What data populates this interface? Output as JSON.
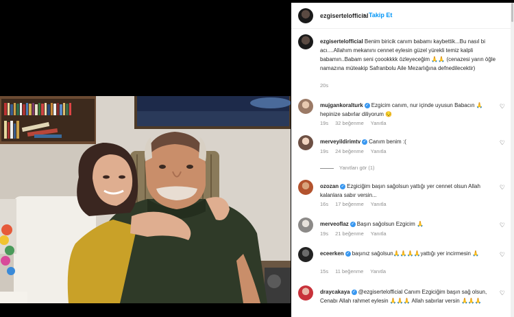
{
  "post": {
    "username": "ezgisertelofficial",
    "follow_dot": "•",
    "follow_label": "Takip Et"
  },
  "caption": {
    "username": "ezgisertelofficial",
    "text": " Benim biricik canım babamı kaybettik...Bu nasıl bi acı....Allahım mekanını cennet eylesin güzel yürekli temiz kalpli babamın..Babam seni çoookkkk özleyeceğim 🙏🙏 (cenazesi yarın öğle namazına müteakip Safranbolu Aile Mezarlığına defnedilecektir)",
    "time": "20s"
  },
  "comments": [
    {
      "username": "mujgankoralturk",
      "verified": true,
      "text": "Ezgicim canım, nur içinde uyusun Babacın 🙏 hepinize sabırlar diliyorum 😔",
      "time": "19s",
      "likes": "32 beğenme",
      "reply": "Yanıtla"
    },
    {
      "username": "merveyildirimtv",
      "verified": true,
      "text": "Canım benim :(",
      "time": "19s",
      "likes": "24 beğenme",
      "reply": "Yanıtla"
    },
    {
      "username": "ozozan",
      "verified": true,
      "text": "Ezgiciğim başın sağolsun yattığı yer cennet olsun Allah kalanlara sabır versin...",
      "time": "16s",
      "likes": "17 beğenme",
      "reply": "Yanıtla"
    },
    {
      "username": "merveoflaz",
      "verified": true,
      "text": "Başın sağolsun Ezgicim 🙏",
      "time": "19s",
      "likes": "21 beğenme",
      "reply": "Yanıtla"
    },
    {
      "username": "eceerken",
      "verified": true,
      "text": "başınız sağolsun🙏🙏🙏🙏yattığı yer incirmesin 🙏",
      "time": "15s",
      "likes": "11 beğenme",
      "reply": "Yanıtla"
    },
    {
      "username": "draycakaya",
      "verified": true,
      "text": "@ezgisertelofficial Canım Ezgiciğim başın sağ olsun, Cenabı Allah rahmet eylesin 🙏🙏🙏 Allah sabırlar versin 🙏🙏🙏",
      "time": "",
      "likes": "",
      "reply": ""
    }
  ],
  "replies_link": "Yanıtları gör (1)",
  "icons": {
    "heart": "heart-icon",
    "verified": "verified-badge-icon"
  },
  "colors": {
    "link": "#0095f6",
    "verified": "#3897f0",
    "muted": "#8e8e8e"
  }
}
